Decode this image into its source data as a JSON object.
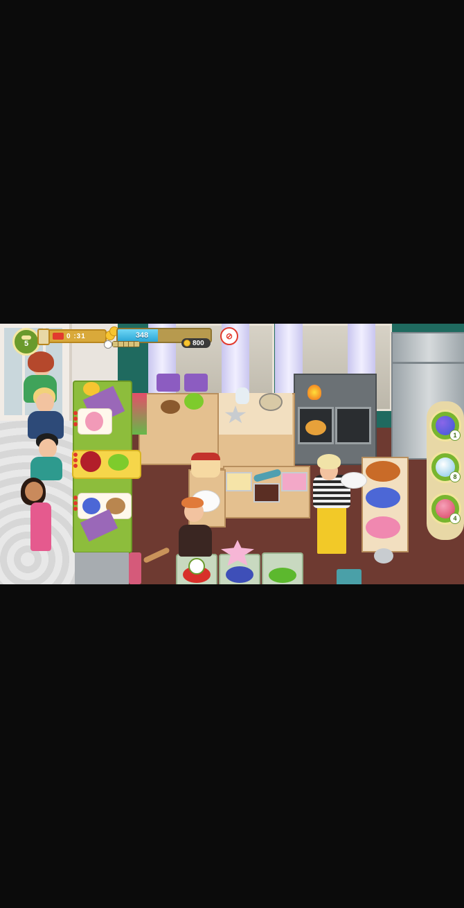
{
  "hud": {
    "level": "5",
    "timer": "0 :31",
    "score": "348",
    "goal": "800",
    "score_progress_percent": 43
  },
  "boosters": [
    {
      "name": "candy-booster",
      "count": "1"
    },
    {
      "name": "bell-booster",
      "count": "8"
    },
    {
      "name": "roller-skate-booster",
      "count": "4"
    }
  ],
  "colors": {
    "wall": "#1f6a5f",
    "floor": "#6e3a31",
    "hud_gold": "#d9a93a",
    "progress_blue": "#2aa6d6",
    "booster_green": "#78b52f"
  },
  "icons": {
    "level": "crowd-icon",
    "timer": "hourglass-icon",
    "coins": "coins-icon",
    "stopwatch": "stopwatch-icon",
    "no_entry": "no-entry-icon"
  }
}
